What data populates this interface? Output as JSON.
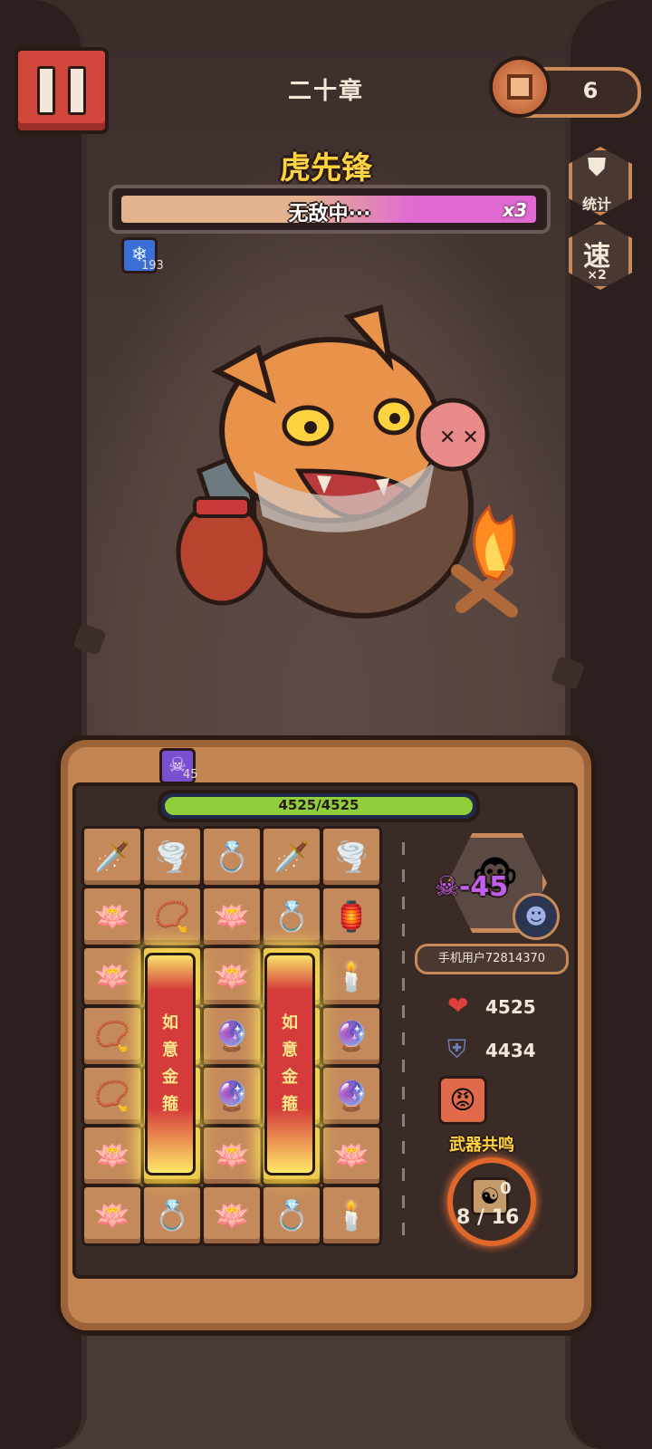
{
  "header": {
    "chapter": "二十章",
    "coins": "6"
  },
  "side_buttons": {
    "stats_label": "统计",
    "speed_glyph": "速",
    "speed_multiplier": "×2"
  },
  "boss": {
    "name": "虎先锋",
    "status": "无敌中···",
    "multiplier": "x3",
    "hp_fraction": 1.0,
    "buff_count": "193"
  },
  "board": {
    "poison_count": "45",
    "hp_text": "4525/4525",
    "hp_fraction": 1.0,
    "pillar_text": "如意金箍",
    "tiles": [
      {
        "icon": "🗡️",
        "name": "sword-tile"
      },
      {
        "icon": "🌪️",
        "name": "wind-tile"
      },
      {
        "icon": "💍",
        "name": "jade-ring-tile"
      },
      {
        "icon": "🗡️",
        "name": "sword-tile"
      },
      {
        "icon": "🌪️",
        "name": "wind-tile"
      },
      {
        "icon": "🪷",
        "name": "lotus-tile"
      },
      {
        "icon": "📿",
        "name": "bracelet-tile"
      },
      {
        "icon": "🪷",
        "name": "lotus-tile"
      },
      {
        "icon": "💍",
        "name": "jade-ring-tile"
      },
      {
        "icon": "🏮",
        "name": "lamp-tile"
      },
      {
        "icon": "🪷",
        "name": "lotus-tile"
      },
      {
        "icon": "",
        "name": "pillar-tile"
      },
      {
        "icon": "🪷",
        "name": "lotus-tile"
      },
      {
        "icon": "",
        "name": "pillar-tile"
      },
      {
        "icon": "🕯️",
        "name": "candle-tile"
      },
      {
        "icon": "📿",
        "name": "bracelet-tile"
      },
      {
        "icon": "",
        "name": "pillar-tile"
      },
      {
        "icon": "🔮",
        "name": "orb-tile"
      },
      {
        "icon": "",
        "name": "pillar-tile"
      },
      {
        "icon": "🔮",
        "name": "orb-tile"
      },
      {
        "icon": "📿",
        "name": "bracelet-tile"
      },
      {
        "icon": "",
        "name": "pillar-tile"
      },
      {
        "icon": "🔮",
        "name": "orb-tile"
      },
      {
        "icon": "",
        "name": "pillar-tile"
      },
      {
        "icon": "🔮",
        "name": "orb-tile"
      },
      {
        "icon": "🪷",
        "name": "lotus-tile"
      },
      {
        "icon": "",
        "name": "pillar-tile"
      },
      {
        "icon": "🪷",
        "name": "lotus-tile"
      },
      {
        "icon": "",
        "name": "pillar-tile"
      },
      {
        "icon": "🪷",
        "name": "lotus-tile"
      },
      {
        "icon": "🪷",
        "name": "lotus-tile"
      },
      {
        "icon": "💍",
        "name": "jade-ring-tile"
      },
      {
        "icon": "🪷",
        "name": "lotus-tile"
      },
      {
        "icon": "💍",
        "name": "jade-ring-tile"
      },
      {
        "icon": "🕯️",
        "name": "candle-tile"
      }
    ]
  },
  "player": {
    "damage_taken": "-45",
    "username": "手机用户72814370",
    "hp": "4525",
    "armor": "4434",
    "resonance_label": "武器共鸣",
    "resonance_count": "0",
    "resonance_progress": "8 / 16"
  },
  "colors": {
    "accent_gold": "#ffd23f",
    "boss_bar_pink": "#e06ad2",
    "hp_green": "#8fcf3e",
    "pause_red": "#d2473c"
  }
}
